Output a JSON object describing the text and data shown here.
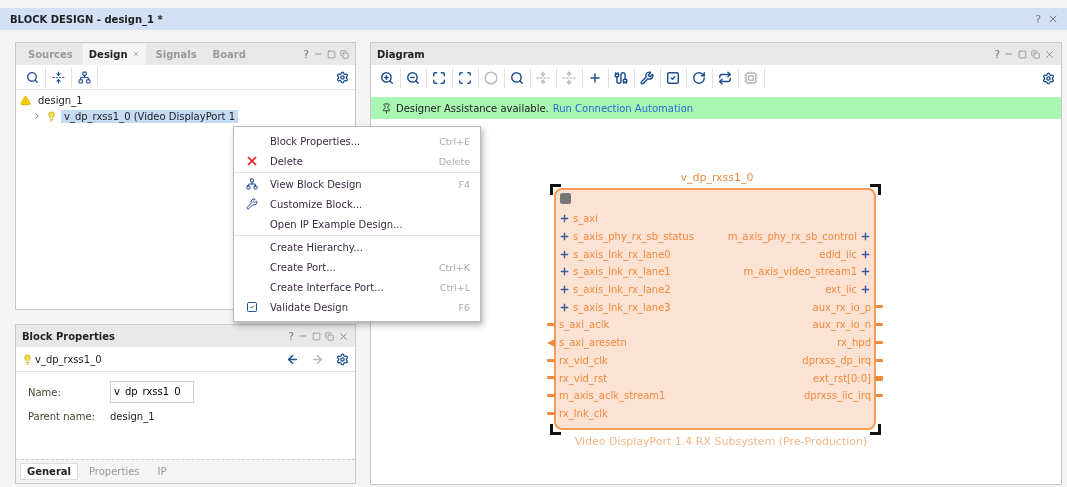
{
  "window": {
    "title": "BLOCK DESIGN - design_1 *",
    "help": "?"
  },
  "sources_panel": {
    "tabs": [
      {
        "label": "Sources",
        "selected": false,
        "closable": false
      },
      {
        "label": "Design",
        "selected": true,
        "closable": true
      },
      {
        "label": "Signals",
        "selected": false,
        "closable": false
      },
      {
        "label": "Board",
        "selected": false,
        "closable": false
      }
    ],
    "help": "?",
    "tree": [
      {
        "label": "design_1",
        "kind": "warning",
        "selected": false,
        "children": [
          {
            "label": "v_dp_rxss1_0 (Video DisplayPort 1",
            "kind": "ip",
            "selected": true,
            "expanded": false
          }
        ]
      }
    ]
  },
  "context_menu": {
    "groups": [
      [
        {
          "label": "Block Properties...",
          "shortcut": "Ctrl+E",
          "kind": "none"
        },
        {
          "label": "Delete",
          "shortcut": "Delete",
          "kind": "delete"
        }
      ],
      [
        {
          "label": "View Block Design",
          "shortcut": "F4",
          "kind": "view"
        },
        {
          "label": "Customize Block...",
          "kind": "customize"
        },
        {
          "label": "Open IP Example Design...",
          "kind": "none"
        }
      ],
      [
        {
          "label": "Create Hierarchy...",
          "kind": "none"
        },
        {
          "label": "Create Port...",
          "shortcut": "Ctrl+K",
          "kind": "none"
        },
        {
          "label": "Create Interface Port...",
          "shortcut": "Ctrl+L",
          "kind": "none"
        },
        {
          "label": "Validate Design",
          "shortcut": "F6",
          "kind": "validate"
        }
      ]
    ]
  },
  "block_properties": {
    "title": "Block Properties",
    "help": "?",
    "object": "v_dp_rxss1_0",
    "fields": [
      {
        "label": "Name:",
        "value": "v_dp_rxss1_0",
        "kind": "input"
      },
      {
        "label": "Parent name:",
        "value": "design_1",
        "kind": "text"
      }
    ],
    "tabs": [
      {
        "label": "General",
        "selected": true
      },
      {
        "label": "Properties",
        "selected": false
      },
      {
        "label": "IP",
        "selected": false
      }
    ]
  },
  "diagram": {
    "title": "Diagram",
    "help": "?",
    "toolbar": [
      {
        "kind": "zoom-in",
        "disabled": false
      },
      {
        "kind": "zoom-out",
        "disabled": false
      },
      {
        "kind": "fit",
        "disabled": false
      },
      {
        "kind": "zoom-area",
        "disabled": false
      },
      {
        "kind": "circle",
        "disabled": true
      },
      {
        "kind": "search",
        "disabled": false
      },
      {
        "kind": "collapse",
        "disabled": true
      },
      {
        "kind": "expand",
        "disabled": true
      },
      {
        "kind": "add",
        "disabled": false
      },
      {
        "kind": "connect",
        "disabled": false
      },
      {
        "kind": "wrench",
        "disabled": false
      },
      {
        "kind": "validate",
        "disabled": false
      },
      {
        "kind": "refresh",
        "disabled": false
      },
      {
        "kind": "regenerate",
        "disabled": false
      },
      {
        "kind": "chip",
        "disabled": true
      }
    ],
    "banner": {
      "text": "Designer Assistance available.",
      "link": "Run Connection Automation"
    },
    "block": {
      "name": "v_dp_rxss1_0",
      "subtitle": "Video DisplayPort 1.4 RX Subsystem (Pre-Production)",
      "selected": true,
      "left_ports": [
        {
          "label": "s_axi",
          "kind": "bus"
        },
        {
          "label": "s_axis_phy_rx_sb_status",
          "kind": "bus"
        },
        {
          "label": "s_axis_lnk_rx_lane0",
          "kind": "bus"
        },
        {
          "label": "s_axis_lnk_rx_lane1",
          "kind": "bus"
        },
        {
          "label": "s_axis_lnk_rx_lane2",
          "kind": "bus"
        },
        {
          "label": "s_axis_lnk_rx_lane3",
          "kind": "bus"
        },
        {
          "label": "s_axi_aclk",
          "kind": "pin"
        },
        {
          "label": "s_axi_aresetn",
          "kind": "reset"
        },
        {
          "label": "rx_vid_clk",
          "kind": "pin"
        },
        {
          "label": "rx_vid_rst",
          "kind": "pin"
        },
        {
          "label": "m_axis_aclk_stream1",
          "kind": "pin"
        },
        {
          "label": "rx_lnk_clk",
          "kind": "pin"
        }
      ],
      "right_ports": [
        {
          "label": "m_axis_phy_rx_sb_control",
          "kind": "bus"
        },
        {
          "label": "edid_iic",
          "kind": "bus"
        },
        {
          "label": "m_axis_video_stream1",
          "kind": "bus"
        },
        {
          "label": "ext_iic",
          "kind": "bus"
        },
        {
          "label": "aux_rx_io_p",
          "kind": "pin"
        },
        {
          "label": "aux_rx_io_n",
          "kind": "pin"
        },
        {
          "label": "rx_hpd",
          "kind": "pin"
        },
        {
          "label": "dprxss_dp_irq",
          "kind": "pin"
        },
        {
          "label": "ext_rst[0:0]",
          "kind": "wide"
        },
        {
          "label": "dprxss_iic_irq",
          "kind": "pin"
        }
      ]
    }
  }
}
